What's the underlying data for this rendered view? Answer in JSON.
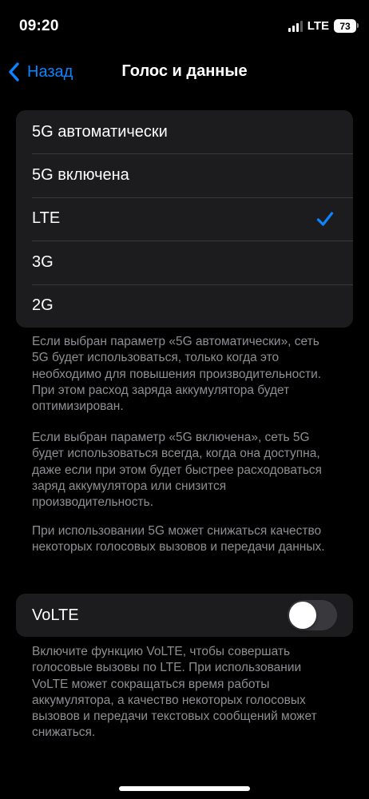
{
  "status_bar": {
    "time": "09:20",
    "network": "LTE",
    "battery": "73",
    "signal_bars_filled": 3,
    "signal_bars_total": 4
  },
  "nav": {
    "back_label": "Назад",
    "title": "Голос и данные"
  },
  "options": [
    {
      "label": "5G автоматически",
      "selected": false
    },
    {
      "label": "5G включена",
      "selected": false
    },
    {
      "label": "LTE",
      "selected": true
    },
    {
      "label": "3G",
      "selected": false
    },
    {
      "label": "2G",
      "selected": false
    }
  ],
  "footers": [
    "Если выбран параметр «5G автоматически», сеть 5G будет использоваться, только когда это необходимо для повышения производительности. При этом расход заряда аккумулятора будет оптимизирован.",
    "Если выбран параметр «5G включена», сеть 5G будет использоваться всегда, когда она доступна, даже если при этом будет быстрее расходоваться заряд аккумулятора или снизится производительность.",
    "При использовании 5G может снижаться качество некоторых голосовых вызовов и передачи данных."
  ],
  "volte": {
    "label": "VoLTE",
    "enabled": false,
    "footer": "Включите функцию VoLTE, чтобы совершать голосовые вызовы по LTE. При использовании VoLTE может сокращаться время работы аккумулятора, а качество некоторых голосовых вызовов и передачи текстовых сообщений может снижаться."
  },
  "colors": {
    "accent": "#0a84ff",
    "background": "#000000",
    "cell": "#1c1c1e",
    "secondary_text": "#8e8e93",
    "toggle_off": "#39393d"
  },
  "icons": {
    "back": "chevron-left-icon",
    "selected": "checkmark-icon"
  }
}
